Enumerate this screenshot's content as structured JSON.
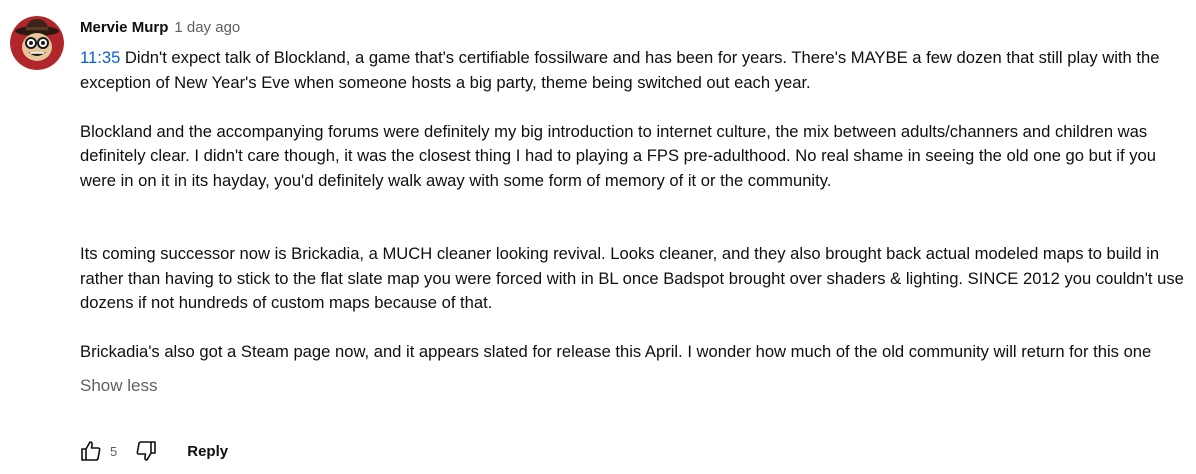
{
  "comment": {
    "author": "Mervie Murp",
    "time": "1 day ago",
    "timestamp_link": "11:35",
    "paragraphs": [
      " Didn't expect talk of Blockland, a game that's certifiable fossilware and has been for years. There's MAYBE a few dozen that still play with the exception of New Year's Eve when someone hosts a big party, theme being switched out each year.",
      "Blockland and the accompanying forums were definitely my big introduction to internet culture, the mix between adults/channers and children was definitely clear. I didn't care though, it was the closest thing I had to playing a FPS pre-adulthood. No real shame in seeing the old one go but if you were in on it in its hayday, you'd definitely walk away with some form of memory of it or the community.",
      "Its coming successor now is Brickadia, a MUCH cleaner looking revival. Looks cleaner, and they also brought back actual modeled maps to build in rather than having to stick to the flat slate map you were forced with in BL once Badspot brought over shaders & lighting. SINCE 2012 you couldn't use dozens if not hundreds of custom maps because of that.",
      "Brickadia's also got a Steam page now, and it appears slated for release this April. I wonder how much of the old community will return for this one"
    ],
    "show_less_label": "Show less",
    "like_count": "5",
    "reply_label": "Reply",
    "icons": {
      "avatar": "avatar-cartoon-face",
      "like": "thumbs-up-icon",
      "dislike": "thumbs-down-icon"
    },
    "colors": {
      "timestamp_link": "#065fd4",
      "secondary_text": "#606060",
      "avatar_bg": "#b0262a"
    }
  }
}
